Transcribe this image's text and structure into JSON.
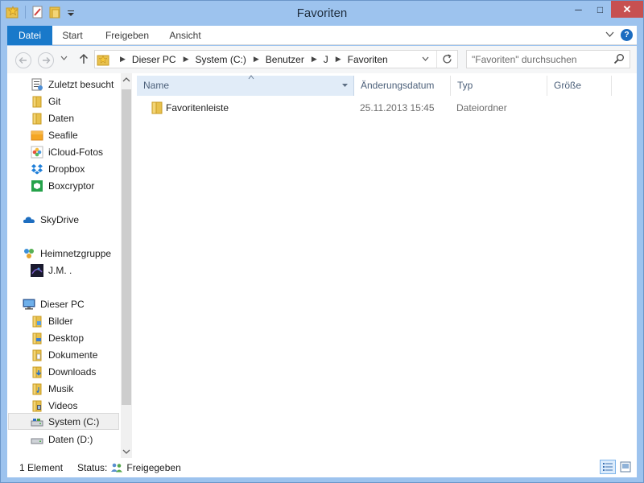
{
  "window": {
    "title": "Favoriten",
    "minimize_glyph": "─",
    "maximize_glyph": "□",
    "close_glyph": "✕"
  },
  "ribbon": {
    "tabs": [
      "Datei",
      "Start",
      "Freigeben",
      "Ansicht"
    ],
    "help_glyph": "?"
  },
  "address": {
    "crumbs": [
      "Dieser PC",
      "System (C:)",
      "Benutzer",
      "J",
      "Favoriten"
    ],
    "search_placeholder": "\"Favoriten\" durchsuchen"
  },
  "nav": {
    "quick_access": [
      {
        "label": "Zuletzt besucht",
        "icon": "recent-places-icon"
      },
      {
        "label": "Git",
        "icon": "folder-icon"
      },
      {
        "label": "Daten",
        "icon": "folder-icon"
      },
      {
        "label": "Seafile",
        "icon": "seafile-icon"
      },
      {
        "label": "iCloud-Fotos",
        "icon": "icloud-photos-icon"
      },
      {
        "label": "Dropbox",
        "icon": "dropbox-icon"
      },
      {
        "label": "Boxcryptor",
        "icon": "boxcryptor-icon"
      }
    ],
    "skydrive": "SkyDrive",
    "homegroup": "Heimnetzgruppe",
    "homegroup_user": "J.M. .",
    "this_pc": "Dieser PC",
    "pc_items": [
      {
        "label": "Bilder",
        "icon": "pictures-folder-icon"
      },
      {
        "label": "Desktop",
        "icon": "desktop-folder-icon"
      },
      {
        "label": "Dokumente",
        "icon": "documents-folder-icon"
      },
      {
        "label": "Downloads",
        "icon": "downloads-folder-icon"
      },
      {
        "label": "Musik",
        "icon": "music-folder-icon"
      },
      {
        "label": "Videos",
        "icon": "videos-folder-icon"
      },
      {
        "label": "System (C:)",
        "icon": "drive-icon",
        "selected": true
      },
      {
        "label": "Daten (D:)",
        "icon": "drive-icon"
      }
    ]
  },
  "columns": {
    "name": "Name",
    "date": "Änderungsdatum",
    "type": "Typ",
    "size": "Größe"
  },
  "files": [
    {
      "name": "Favoritenleiste",
      "date": "25.11.2013 15:45",
      "type": "Dateiordner",
      "size": ""
    }
  ],
  "status": {
    "count": "1 Element",
    "label": "Status:",
    "value": "Freigegeben"
  },
  "colors": {
    "accent": "#1979ca",
    "frame": "#9dc3ee",
    "folder": "#e8c14d"
  }
}
